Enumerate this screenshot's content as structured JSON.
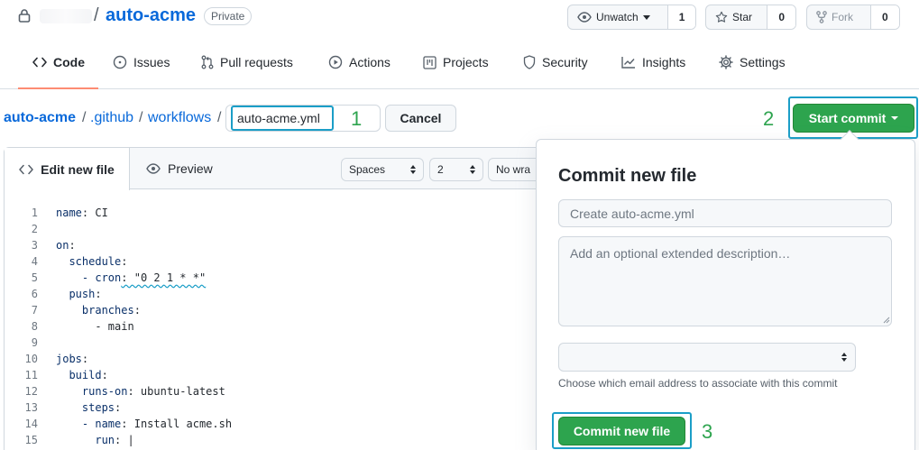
{
  "repo": {
    "name": "auto-acme",
    "visibility": "Private",
    "watch": {
      "label": "Unwatch",
      "count": "1"
    },
    "star": {
      "label": "Star",
      "count": "0"
    },
    "fork": {
      "label": "Fork",
      "count": "0"
    }
  },
  "nav": {
    "tabs": [
      {
        "label": "Code",
        "icon": "code-icon",
        "active": true
      },
      {
        "label": "Issues",
        "icon": "issue-icon"
      },
      {
        "label": "Pull requests",
        "icon": "pull-request-icon"
      },
      {
        "label": "Actions",
        "icon": "play-icon"
      },
      {
        "label": "Projects",
        "icon": "project-icon"
      },
      {
        "label": "Security",
        "icon": "shield-icon"
      },
      {
        "label": "Insights",
        "icon": "graph-icon"
      },
      {
        "label": "Settings",
        "icon": "gear-icon"
      }
    ]
  },
  "breadcrumb": {
    "root": "auto-acme",
    "sep": "/",
    "dir1": ".github",
    "dir2": "workflows"
  },
  "filename": {
    "value": "auto-acme.yml"
  },
  "buttons": {
    "cancel": "Cancel",
    "start_commit": "Start commit"
  },
  "steps": {
    "one": "1",
    "two": "2",
    "three": "3"
  },
  "editor": {
    "tab_edit": "Edit new file",
    "tab_preview": "Preview",
    "indent_mode": "Spaces",
    "indent_size": "2",
    "wrap_mode": "No wra",
    "lines": [
      {
        "n": "1",
        "key": "name",
        "rest": ": CI",
        "indent": ""
      },
      {
        "n": "2",
        "key": "",
        "rest": "",
        "indent": ""
      },
      {
        "n": "3",
        "key": "on",
        "rest": ":",
        "indent": ""
      },
      {
        "n": "4",
        "key": "schedule",
        "rest": ":",
        "indent": "  "
      },
      {
        "n": "5",
        "key": "- cron",
        "rest": ": \"0 2 1 * *\"",
        "indent": "    "
      },
      {
        "n": "6",
        "key": "push",
        "rest": ":",
        "indent": "  "
      },
      {
        "n": "7",
        "key": "branches",
        "rest": ":",
        "indent": "    "
      },
      {
        "n": "8",
        "key": "",
        "rest": "- main",
        "indent": "      "
      },
      {
        "n": "9",
        "key": "",
        "rest": "",
        "indent": ""
      },
      {
        "n": "10",
        "key": "jobs",
        "rest": ":",
        "indent": ""
      },
      {
        "n": "11",
        "key": "build",
        "rest": ":",
        "indent": "  "
      },
      {
        "n": "12",
        "key": "runs-on",
        "rest": ": ubuntu-latest",
        "indent": "    "
      },
      {
        "n": "13",
        "key": "steps",
        "rest": ":",
        "indent": "    "
      },
      {
        "n": "14",
        "key": "- name",
        "rest": ": Install acme.sh",
        "indent": "    "
      },
      {
        "n": "15",
        "key": "run",
        "rest": ": |",
        "indent": "      "
      }
    ]
  },
  "commit_panel": {
    "title": "Commit new file",
    "summary_placeholder": "Create auto-acme.yml",
    "description_placeholder": "Add an optional extended description…",
    "email_hint": "Choose which email address to associate with this commit",
    "submit": "Commit new file"
  },
  "colors": {
    "link": "#0969da",
    "primary": "#2da44e",
    "highlight_frame": "#1b9ec7",
    "step_number": "#2ea44f",
    "nav_underline": "#fd8c73"
  }
}
